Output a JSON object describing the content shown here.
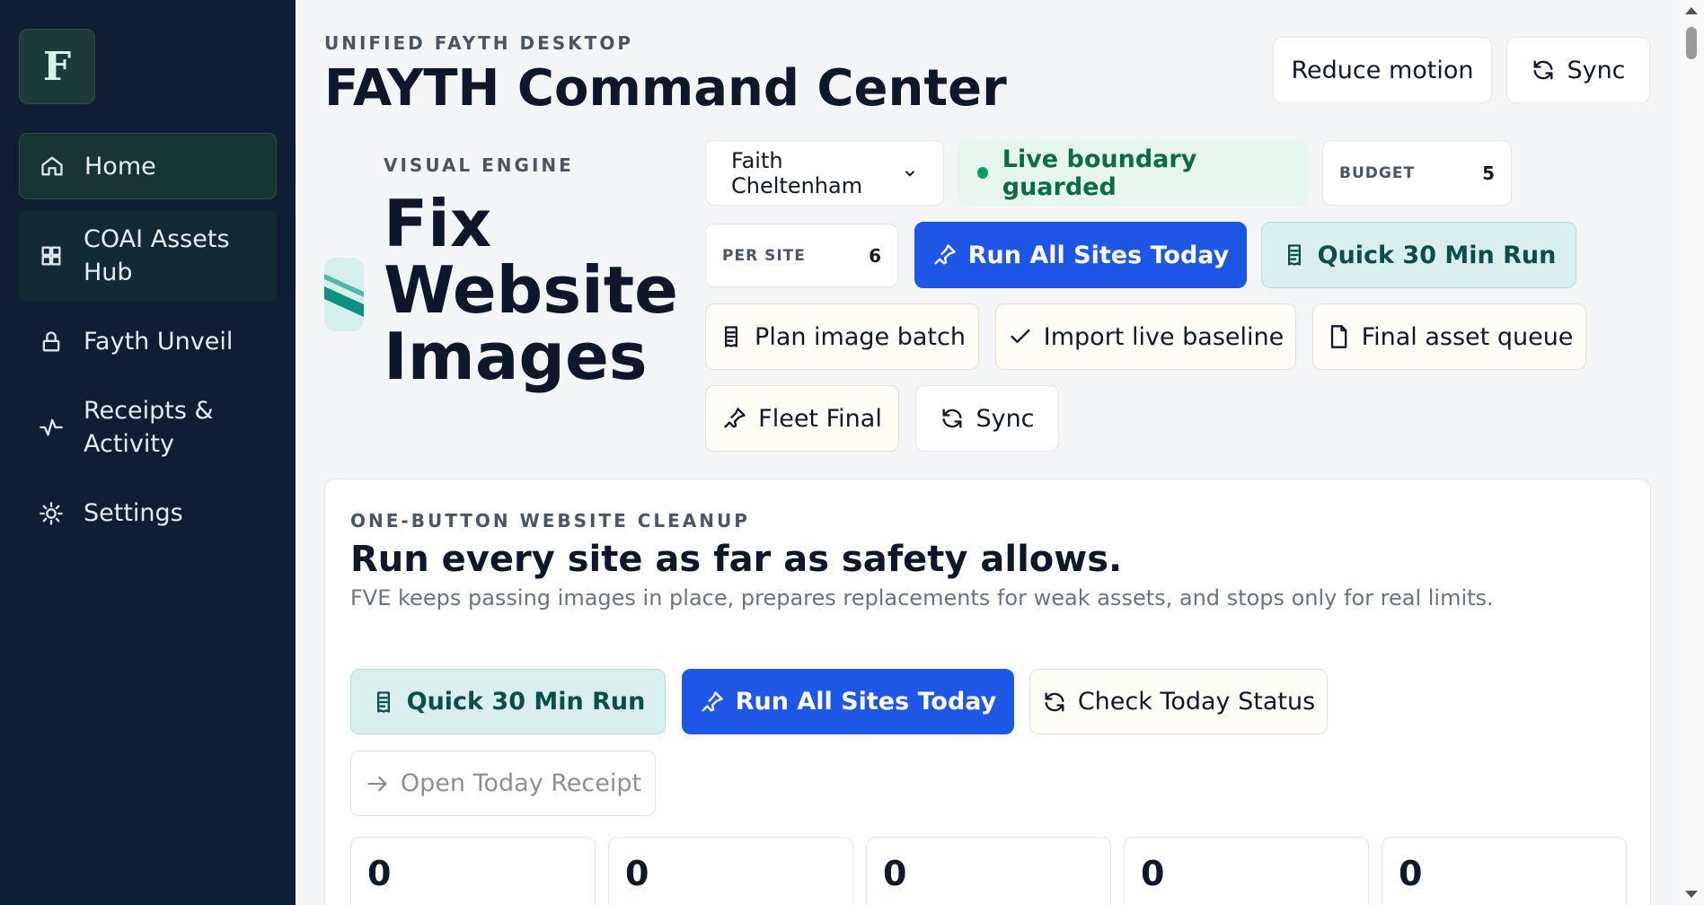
{
  "sidebar": {
    "logo_letter": "F",
    "items": [
      {
        "label": "Home",
        "icon": "home-icon"
      },
      {
        "label": "COAI Assets Hub",
        "icon": "grid-icon"
      },
      {
        "label": "Fayth Unveil",
        "icon": "lock-icon"
      },
      {
        "label": "Receipts & Activity",
        "icon": "activity-icon"
      },
      {
        "label": "Settings",
        "icon": "sun-icon"
      }
    ]
  },
  "header": {
    "eyebrow": "UNIFIED FAYTH DESKTOP",
    "title": "FAYTH Command Center",
    "reduce_motion": "Reduce motion",
    "sync": "Sync"
  },
  "engine": {
    "eyebrow": "VISUAL ENGINE",
    "title_line1": "Fix",
    "title_line2": "Website",
    "title_line3": "Images",
    "user_select": "Faith Cheltenham",
    "live_status": "Live boundary guarded",
    "budget_label": "BUDGET",
    "budget_value": "5",
    "per_site_label": "PER SITE",
    "per_site_value": "6",
    "run_all": "Run All Sites Today",
    "quick_run": "Quick 30 Min Run",
    "plan_batch": "Plan image batch",
    "import_baseline": "Import live baseline",
    "final_queue": "Final asset queue",
    "fleet_final": "Fleet Final",
    "sync": "Sync"
  },
  "cleanup": {
    "eyebrow": "ONE-BUTTON WEBSITE CLEANUP",
    "heading": "Run every site as far as safety allows.",
    "description": "FVE keeps passing images in place, prepares replacements for weak assets, and stops only for real limits.",
    "quick_run": "Quick 30 Min Run",
    "run_all": "Run All Sites Today",
    "check_status": "Check Today Status",
    "open_receipt": "Open Today Receipt",
    "counts": [
      "0",
      "0",
      "0",
      "0",
      "0"
    ]
  },
  "colors": {
    "sidebar_bg": "#0f1e33",
    "primary": "#1e56e6",
    "mint": "#d8efee",
    "live_green": "#0a6b45"
  }
}
